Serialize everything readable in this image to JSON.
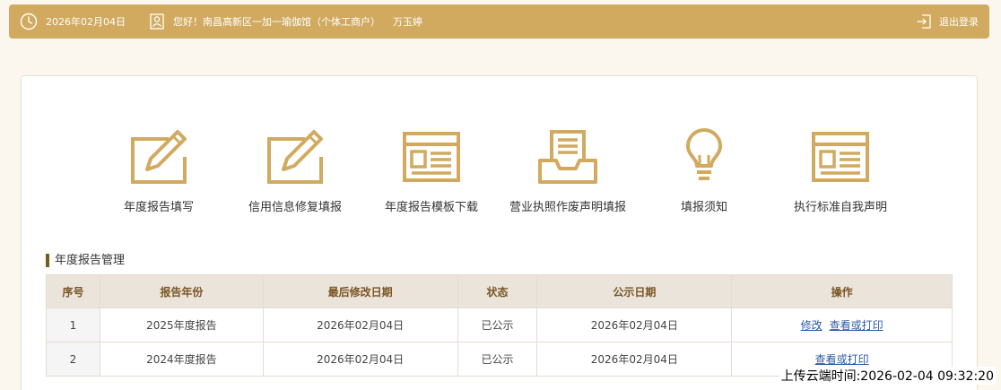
{
  "topbar": {
    "date": "2026年02月04日",
    "greeting": "您好！南昌高新区一加一瑜伽馆（个体工商户）",
    "user_name": "万玉婷",
    "logout": "退出登录"
  },
  "features": [
    {
      "label": "年度报告填写",
      "icon": "edit-pencil-icon"
    },
    {
      "label": "信用信息修复填报",
      "icon": "edit-pencil-icon"
    },
    {
      "label": "年度报告模板下载",
      "icon": "template-window-icon"
    },
    {
      "label": "营业执照作废声明填报",
      "icon": "inbox-tray-icon"
    },
    {
      "label": "填报须知",
      "icon": "lightbulb-icon"
    },
    {
      "label": "执行标准自我声明",
      "icon": "template-window-icon"
    }
  ],
  "section": {
    "title": "年度报告管理"
  },
  "table": {
    "headers": [
      "序号",
      "报告年份",
      "最后修改日期",
      "状态",
      "公示日期",
      "操作"
    ],
    "rows": [
      {
        "no": "1",
        "year": "2025年度报告",
        "modified": "2026年02月04日",
        "status": "已公示",
        "published": "2026年02月04日",
        "actions": [
          "修改",
          "查看或打印"
        ]
      },
      {
        "no": "2",
        "year": "2024年度报告",
        "modified": "2026年02月04日",
        "status": "已公示",
        "published": "2026年02月04日",
        "actions": [
          "查看或打印"
        ]
      }
    ]
  },
  "stamp": "上传云端时间:2026-02-04 09:32:20",
  "colors": {
    "accent": "#d1aa5f",
    "header_text": "#7a5524",
    "link": "#2d5aa8"
  }
}
